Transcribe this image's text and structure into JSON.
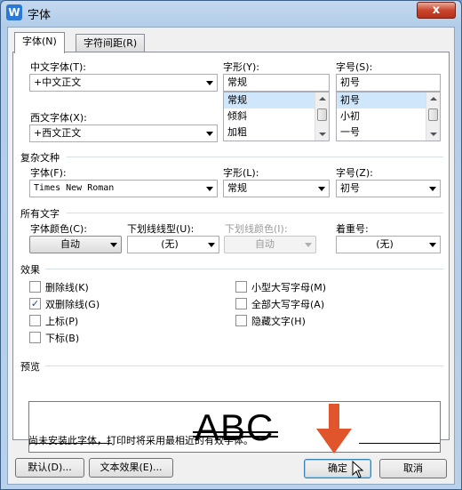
{
  "window": {
    "title": "字体",
    "app_icon": "W",
    "close": "x"
  },
  "tabs": [
    {
      "label": "字体(N)"
    },
    {
      "label": "字符间距(R)"
    }
  ],
  "chinese_font": {
    "label": "中文字体(T):",
    "value": "+中文正文"
  },
  "western_font": {
    "label": "西文字体(X):",
    "value": "+西文正文"
  },
  "style": {
    "label": "字形(Y):",
    "value": "常规",
    "items": [
      "常规",
      "倾斜",
      "加粗"
    ]
  },
  "size": {
    "label": "字号(S):",
    "value": "初号",
    "items": [
      "初号",
      "小初",
      "一号"
    ]
  },
  "complex": {
    "section": "复杂文种",
    "font_label": "字体(F):",
    "font_value": "Times New Roman",
    "style_label": "字形(L):",
    "style_value": "常规",
    "size_label": "字号(Z):",
    "size_value": "初号"
  },
  "all_text": {
    "section": "所有文字",
    "color_label": "字体颜色(C):",
    "color_value": "自动",
    "underline_label": "下划线线型(U):",
    "underline_value": "(无)",
    "underline_color_label": "下划线颜色(I):",
    "underline_color_value": "自动",
    "emphasis_label": "着重号:",
    "emphasis_value": "(无)"
  },
  "effects": {
    "section": "效果",
    "left": [
      {
        "label": "删除线(K)",
        "checked": false
      },
      {
        "label": "双删除线(G)",
        "checked": true
      },
      {
        "label": "上标(P)",
        "checked": false
      },
      {
        "label": "下标(B)",
        "checked": false
      }
    ],
    "right": [
      {
        "label": "小型大写字母(M)",
        "checked": false
      },
      {
        "label": "全部大写字母(A)",
        "checked": false
      },
      {
        "label": "隐藏文字(H)",
        "checked": false
      }
    ],
    "check_mark": "✓"
  },
  "preview": {
    "section": "预览",
    "sample": "ABC",
    "note": "尚未安装此字体，打印时将采用最相近的有效字体。"
  },
  "buttons": {
    "default": "默认(D)...",
    "text_effects": "文本效果(E)...",
    "ok": "确定",
    "cancel": "取消"
  },
  "colors": {
    "highlight_arrow": "#e0552b",
    "selection": "#cfe6fb"
  }
}
